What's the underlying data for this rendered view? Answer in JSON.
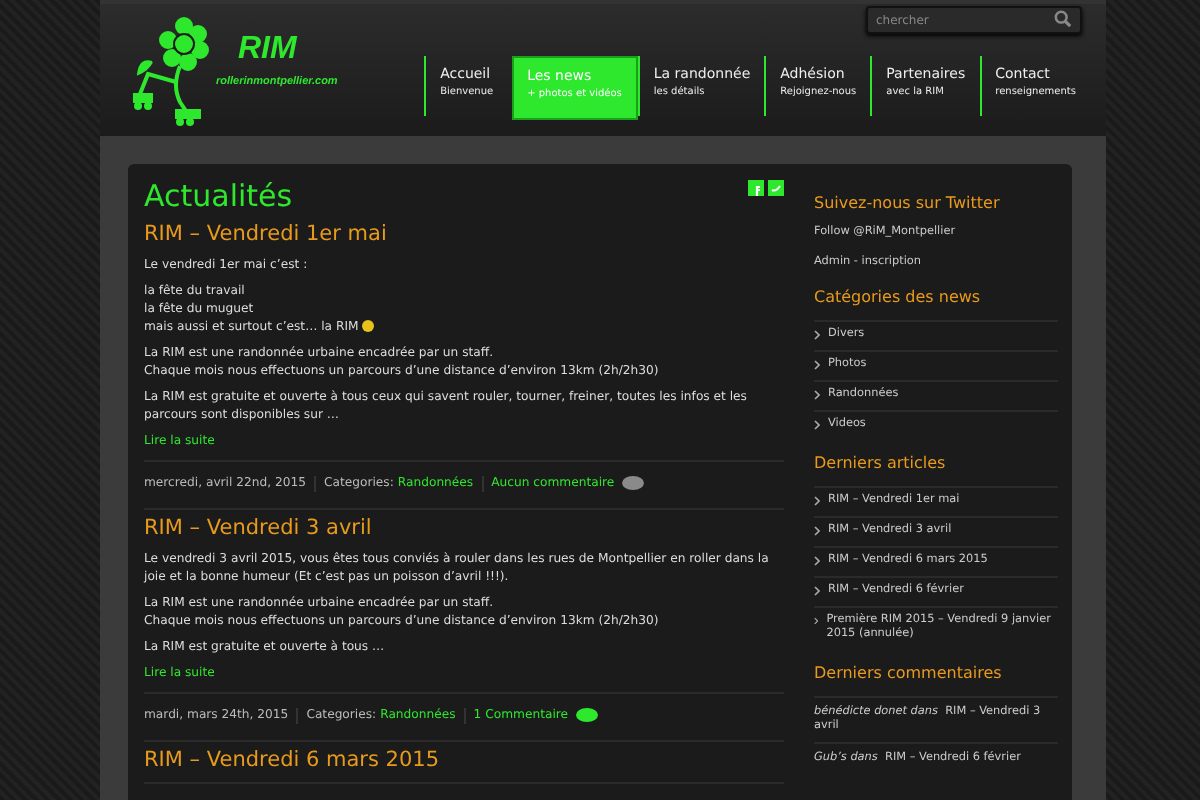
{
  "logo": {
    "title": "RIM",
    "url": "rollerinmontpellier.com"
  },
  "search": {
    "placeholder": "chercher"
  },
  "nav": [
    {
      "label": "Accueil",
      "sub": "Bienvenue",
      "selected": false
    },
    {
      "label": "Les news",
      "sub": "+ photos et vidéos",
      "selected": true
    },
    {
      "label": "La randonnée",
      "sub": "les détails",
      "selected": false
    },
    {
      "label": "Adhésion",
      "sub": "Rejoignez-nous",
      "selected": false
    },
    {
      "label": "Partenaires",
      "sub": "avec la RIM",
      "selected": false
    },
    {
      "label": "Contact",
      "sub": "renseignements",
      "selected": false
    }
  ],
  "page_title": "Actualités",
  "posts": [
    {
      "title": "RIM – Vendredi 1er mai",
      "paragraphs": [
        {
          "lines": [
            "Le vendredi 1er mai c’est :"
          ],
          "smiley": false
        },
        {
          "lines": [
            "la fête du travail",
            "la fête du muguet",
            "mais aussi et surtout c’est… la RIM"
          ],
          "smiley": true
        },
        {
          "lines": [
            "La RIM est une randonnée urbaine encadrée par un staff.",
            "Chaque mois nous effectuons un parcours d’une distance d’environ 13km (2h/2h30)"
          ],
          "smiley": false
        },
        {
          "lines": [
            "La RIM est gratuite et ouverte à tous ceux qui savent rouler, tourner, freiner, toutes les infos et les parcours sont disponibles sur …"
          ],
          "smiley": false
        }
      ],
      "more": "Lire la suite",
      "date": "mercredi, avril 22nd, 2015",
      "categories_label": "Categories:",
      "category": "Randonnées",
      "comments": "Aucun commentaire",
      "has_comments": false
    },
    {
      "title": "RIM – Vendredi 3 avril",
      "paragraphs": [
        {
          "lines": [
            "Le vendredi 3 avril 2015, vous êtes tous conviés à rouler dans les rues de Montpellier en roller dans la joie et la bonne humeur (Et c’est pas un poisson d’avril !!!)."
          ],
          "smiley": false
        },
        {
          "lines": [
            "La RIM est une randonnée urbaine encadrée par un staff.",
            "Chaque mois nous effectuons un parcours d’une distance d’environ 13km (2h/2h30)"
          ],
          "smiley": false
        },
        {
          "lines": [
            "La RIM est gratuite et ouverte à tous …"
          ],
          "smiley": false
        }
      ],
      "more": "Lire la suite",
      "date": "mardi, mars 24th, 2015",
      "categories_label": "Categories:",
      "category": "Randonnées",
      "comments": "1 Commentaire",
      "has_comments": true
    },
    {
      "title": "RIM – Vendredi 6 mars 2015"
    }
  ],
  "sidebar": {
    "twitter": {
      "title": "Suivez-nous sur Twitter",
      "follow": "Follow @RiM_Montpellier",
      "admin": "Admin - inscription"
    },
    "categories": {
      "title": "Catégories des news",
      "items": [
        "Divers",
        "Photos",
        "Randonnées",
        "Videos"
      ]
    },
    "articles": {
      "title": "Derniers articles",
      "items": [
        "RIM – Vendredi 1er mai",
        "RIM – Vendredi 3 avril",
        "RIM – Vendredi 6 mars 2015",
        "RIM – Vendredi 6 février",
        "Première RIM 2015 – Vendredi 9 janvier 2015 (annulée)"
      ]
    },
    "comments": {
      "title": "Derniers commentaires",
      "items": [
        {
          "author": "bénédicte donet dans",
          "post": "RIM – Vendredi 3 avril"
        },
        {
          "author": "Gub’s dans",
          "post": "RIM – Vendredi 6 février"
        }
      ]
    }
  }
}
